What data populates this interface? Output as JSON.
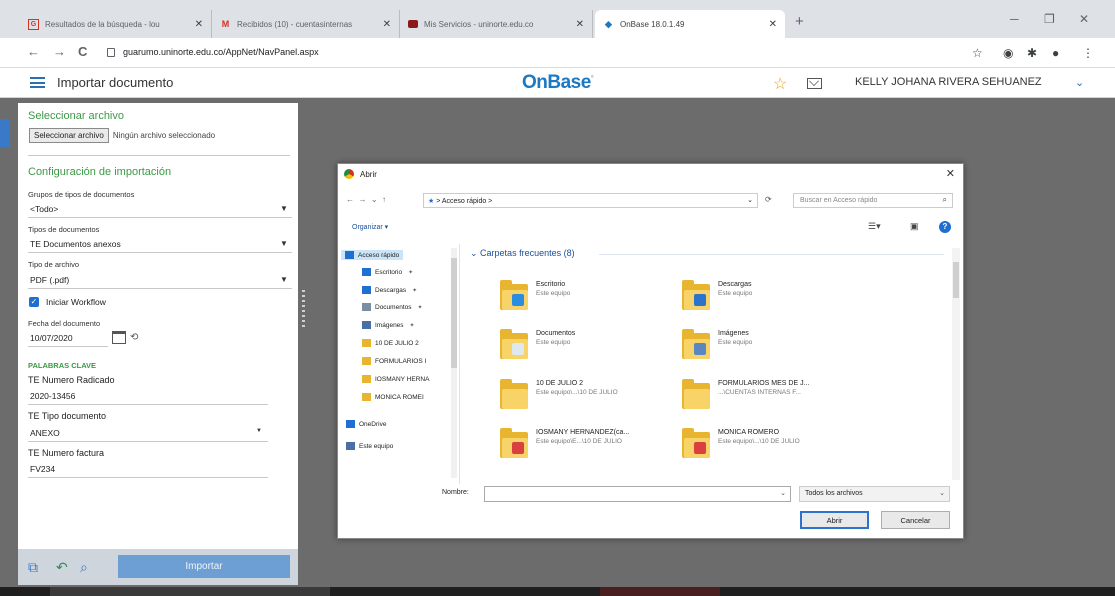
{
  "browser": {
    "tabs": [
      {
        "title": "Resultados de la búsqueda - lou",
        "icon": "search-favicon",
        "color": "#d93025"
      },
      {
        "title": "Recibidos (10) - cuentasinternas",
        "icon": "gmail-favicon",
        "color": "#d93025"
      },
      {
        "title": "Mis Servicios - uninorte.edu.co",
        "icon": "briefcase-favicon",
        "color": "#8b1a1a"
      },
      {
        "title": "OnBase 18.0.1.49",
        "icon": "onbase-favicon",
        "color": "#1b79c4"
      }
    ],
    "new_tab": "+",
    "window_controls": [
      "─",
      "❐",
      "✕"
    ],
    "nav": {
      "back": "←",
      "forward": "→",
      "reload": "C"
    },
    "url": "guarumo.uninorte.edu.co/AppNet/NavPanel.aspx"
  },
  "header": {
    "page_title": "Importar documento",
    "logo": "OnBase",
    "user_name": "KELLY JOHANA RIVERA SEHUANEZ",
    "star": "☆",
    "chevron": "⌄"
  },
  "panel": {
    "select_file_heading": "Seleccionar archivo",
    "select_file_button": "Seleccionar archivo",
    "no_file_text": "Ningún archivo seleccionado",
    "import_config_heading": "Configuración de importación",
    "doc_type_groups_label": "Grupos de tipos de documentos",
    "doc_type_groups_value": "<Todo>",
    "doc_types_label": "Tipos de documentos",
    "doc_types_value": "TE Documentos anexos",
    "file_type_label": "Tipo de archivo",
    "file_type_value": "PDF (.pdf)",
    "workflow_label": "Iniciar Workflow",
    "doc_date_label": "Fecha del documento",
    "doc_date_value": "10/07/2020",
    "keywords_heading": "PALABRAS CLAVE",
    "radicado_label": "TE Numero Radicado",
    "radicado_value": "2020-13456",
    "tipo_doc_label": "TE Tipo documento",
    "tipo_doc_value": "ANEXO",
    "factura_label": "TE Numero factura",
    "factura_value": "FV234",
    "import_button": "Importar"
  },
  "dialog": {
    "title": "Abrir",
    "path": "Acceso rápido",
    "search_placeholder": "Buscar en Acceso rápido",
    "organize": "Organizar ▾",
    "nav_items": [
      {
        "label": "Acceso rápido",
        "color": "#1f6fd1"
      },
      {
        "label": "Escritorio",
        "color": "#1f6fd1"
      },
      {
        "label": "Descargas",
        "color": "#1f6fd1"
      },
      {
        "label": "Documentos",
        "color": "#7a8ea3"
      },
      {
        "label": "Imágenes",
        "color": "#4a6fa5"
      },
      {
        "label": "10 DE JULIO 2",
        "color": "#e8b530"
      },
      {
        "label": "FORMULARIOS I",
        "color": "#e8b530"
      },
      {
        "label": "IOSMANY HERNA",
        "color": "#e8b530"
      },
      {
        "label": "MONICA ROMEI",
        "color": "#e8b530"
      },
      {
        "label": "OneDrive",
        "color": "#1f6fd1"
      },
      {
        "label": "Este equipo",
        "color": "#4a6fa5"
      }
    ],
    "group_header": "Carpetas frecuentes (8)",
    "folders": [
      {
        "name": "Escritorio",
        "sub": "Este equipo",
        "badge": "#2b8de0"
      },
      {
        "name": "Descargas",
        "sub": "Este equipo",
        "badge": "#2b73cc"
      },
      {
        "name": "Documentos",
        "sub": "Este equipo",
        "badge": "#dfe7ef"
      },
      {
        "name": "Imágenes",
        "sub": "Este equipo",
        "badge": "#5b87c0"
      },
      {
        "name": "10 DE JULIO 2",
        "sub": "Este equipo\\...\\10 DE JULIO",
        "badge": "#f7d368"
      },
      {
        "name": "FORMULARIOS MES DE J...",
        "sub": "...\\CUENTAS INTERNAS F...",
        "badge": "#f7d368"
      },
      {
        "name": "IOSMANY HERNANDEZ(ca...",
        "sub": "Este equipo\\E...\\10 DE JULIO",
        "badge": "#d94040"
      },
      {
        "name": "MONICA ROMERO",
        "sub": "Este equipo\\...\\10 DE JULIO",
        "badge": "#d94040"
      }
    ],
    "name_label": "Nombre:",
    "filter_value": "Todos los archivos",
    "open_button": "Abrir",
    "cancel_button": "Cancelar"
  }
}
